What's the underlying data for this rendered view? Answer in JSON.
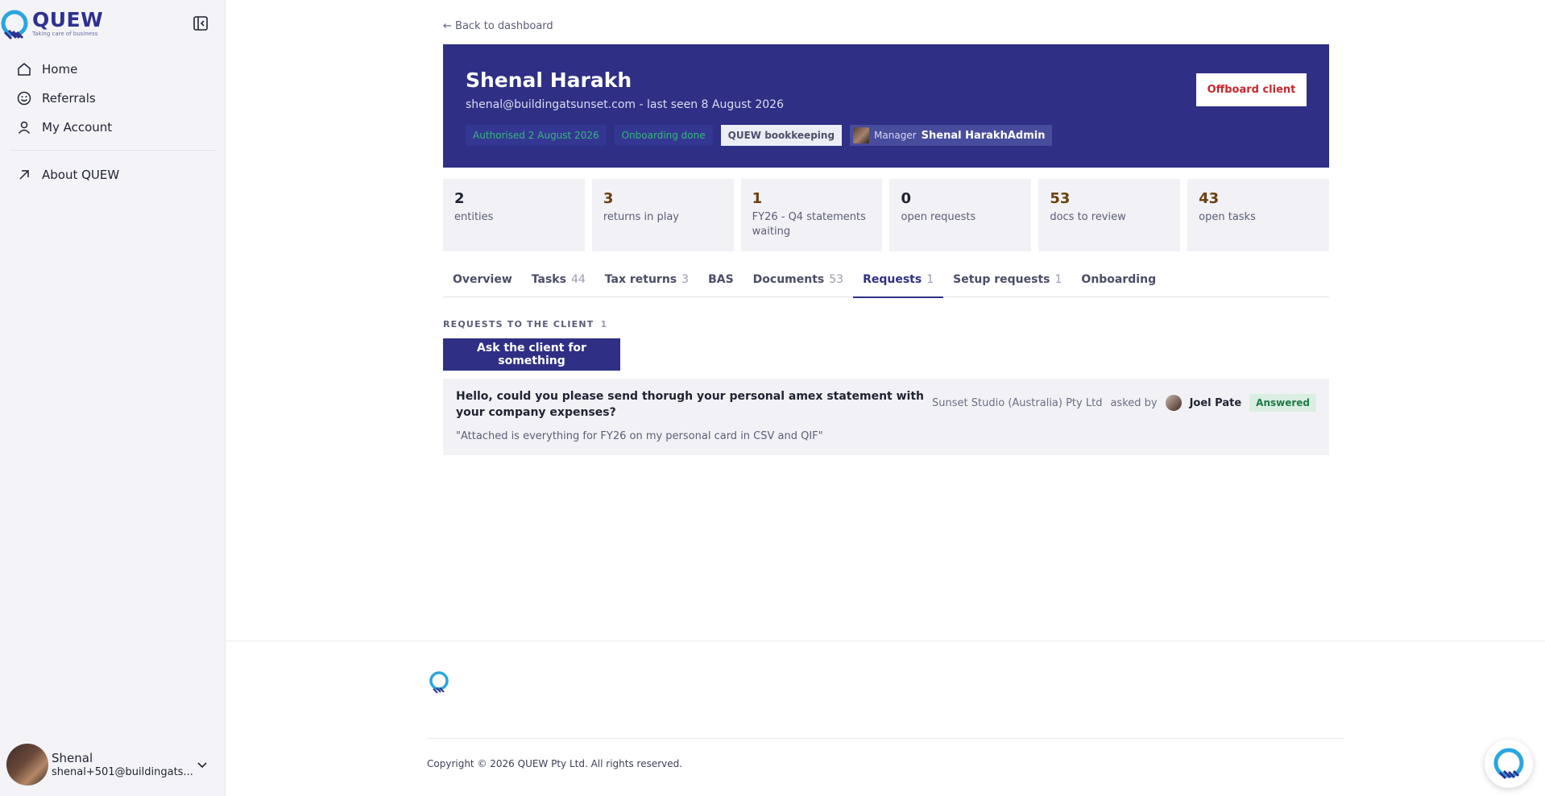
{
  "sidebar": {
    "logo": {
      "name": "QUEW",
      "tagline": "Taking care of business"
    },
    "nav": [
      {
        "label": "Home",
        "icon": "home-icon"
      },
      {
        "label": "Referrals",
        "icon": "smiley-icon"
      },
      {
        "label": "My Account",
        "icon": "user-icon"
      }
    ],
    "about": {
      "label": "About QUEW",
      "icon": "arrow-up-right-icon"
    },
    "user": {
      "name": "Shenal",
      "email": "shenal+501@buildingats..."
    }
  },
  "main": {
    "back_link": "← Back to dashboard",
    "client": {
      "name": "Shenal Harakh",
      "subtitle": "shenal@buildingatsunset.com - last seen 8 August 2026",
      "badges": {
        "authorised": "Authorised 2 August 2026",
        "onboarding": "Onboarding done",
        "service": "QUEW bookkeeping",
        "manager_label": "Manager",
        "manager_name": "Shenal HarakhAdmin"
      },
      "offboard_label": "Offboard client"
    },
    "stats": [
      {
        "value": "2",
        "label": "entities"
      },
      {
        "value": "3",
        "label": "returns in play"
      },
      {
        "value": "1",
        "label": "FY26 - Q4 statements waiting"
      },
      {
        "value": "0",
        "label": "open requests"
      },
      {
        "value": "53",
        "label": "docs to review"
      },
      {
        "value": "43",
        "label": "open tasks"
      }
    ],
    "tabs": [
      {
        "label": "Overview",
        "count": ""
      },
      {
        "label": "Tasks",
        "count": "44"
      },
      {
        "label": "Tax returns",
        "count": "3"
      },
      {
        "label": "BAS",
        "count": ""
      },
      {
        "label": "Documents",
        "count": "53"
      },
      {
        "label": "Requests",
        "count": "1"
      },
      {
        "label": "Setup requests",
        "count": "1"
      },
      {
        "label": "Onboarding",
        "count": ""
      }
    ],
    "active_tab": "Requests",
    "requests": {
      "section_title": "REQUESTS TO THE CLIENT",
      "section_count": "1",
      "ask_button": "Ask the client for something",
      "items": [
        {
          "question": "Hello, could you please send thorugh your personal amex statement with your company expenses?",
          "answer": "\"Attached is everything for FY26 on my personal card in CSV and QIF\"",
          "entity": "Sunset Studio (Australia) Pty Ltd",
          "asked_by_label": "asked by",
          "asked_by": "Joel Pate",
          "status": "Answered"
        }
      ]
    }
  },
  "footer": {
    "copyright": "Copyright © 2026 QUEW Pty Ltd. All rights reserved."
  },
  "colors": {
    "brand": "#2e2f85",
    "danger": "#c5282d",
    "success": "#1f7a46",
    "stat_highlight": "#6b3f0c"
  }
}
